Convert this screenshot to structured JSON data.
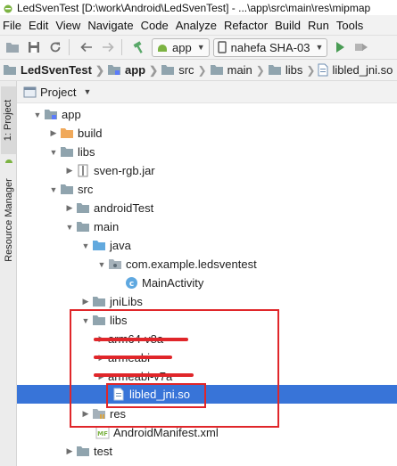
{
  "window": {
    "title": "LedSvenTest [D:\\work\\Android\\LedSvenTest] - ...\\app\\src\\main\\res\\mipmap"
  },
  "menu": [
    "File",
    "Edit",
    "View",
    "Navigate",
    "Code",
    "Analyze",
    "Refactor",
    "Build",
    "Run",
    "Tools"
  ],
  "toolbar": {
    "module": "app",
    "device": "nahefa SHA-03"
  },
  "breadcrumb": [
    "LedSvenTest",
    "app",
    "src",
    "main",
    "libs",
    "libled_jni.so"
  ],
  "sidebar": {
    "project_tab": "1: Project",
    "resource_tab": "Resource Manager"
  },
  "pane": {
    "title": "Project"
  },
  "tree": {
    "app": "app",
    "build": "build",
    "libs": "libs",
    "sven_jar": "sven-rgb.jar",
    "src": "src",
    "androidTest": "androidTest",
    "main": "main",
    "java": "java",
    "package": "com.example.ledsventest",
    "main_activity": "MainActivity",
    "jniLibs": "jniLibs",
    "main_libs": "libs",
    "arm64": "arm64-v8a",
    "armeabi": "armeabi",
    "armeabi_v7a": "armeabi-v7a",
    "libled": "libled_jni.so",
    "res": "res",
    "manifest": "AndroidManifest.xml",
    "test": "test"
  },
  "colors": {
    "selection": "#3874d8",
    "annotation": "#e0262a",
    "folder": "#90a4ae",
    "build_folder": "#f0a95b",
    "java_folder": "#62a9de"
  }
}
